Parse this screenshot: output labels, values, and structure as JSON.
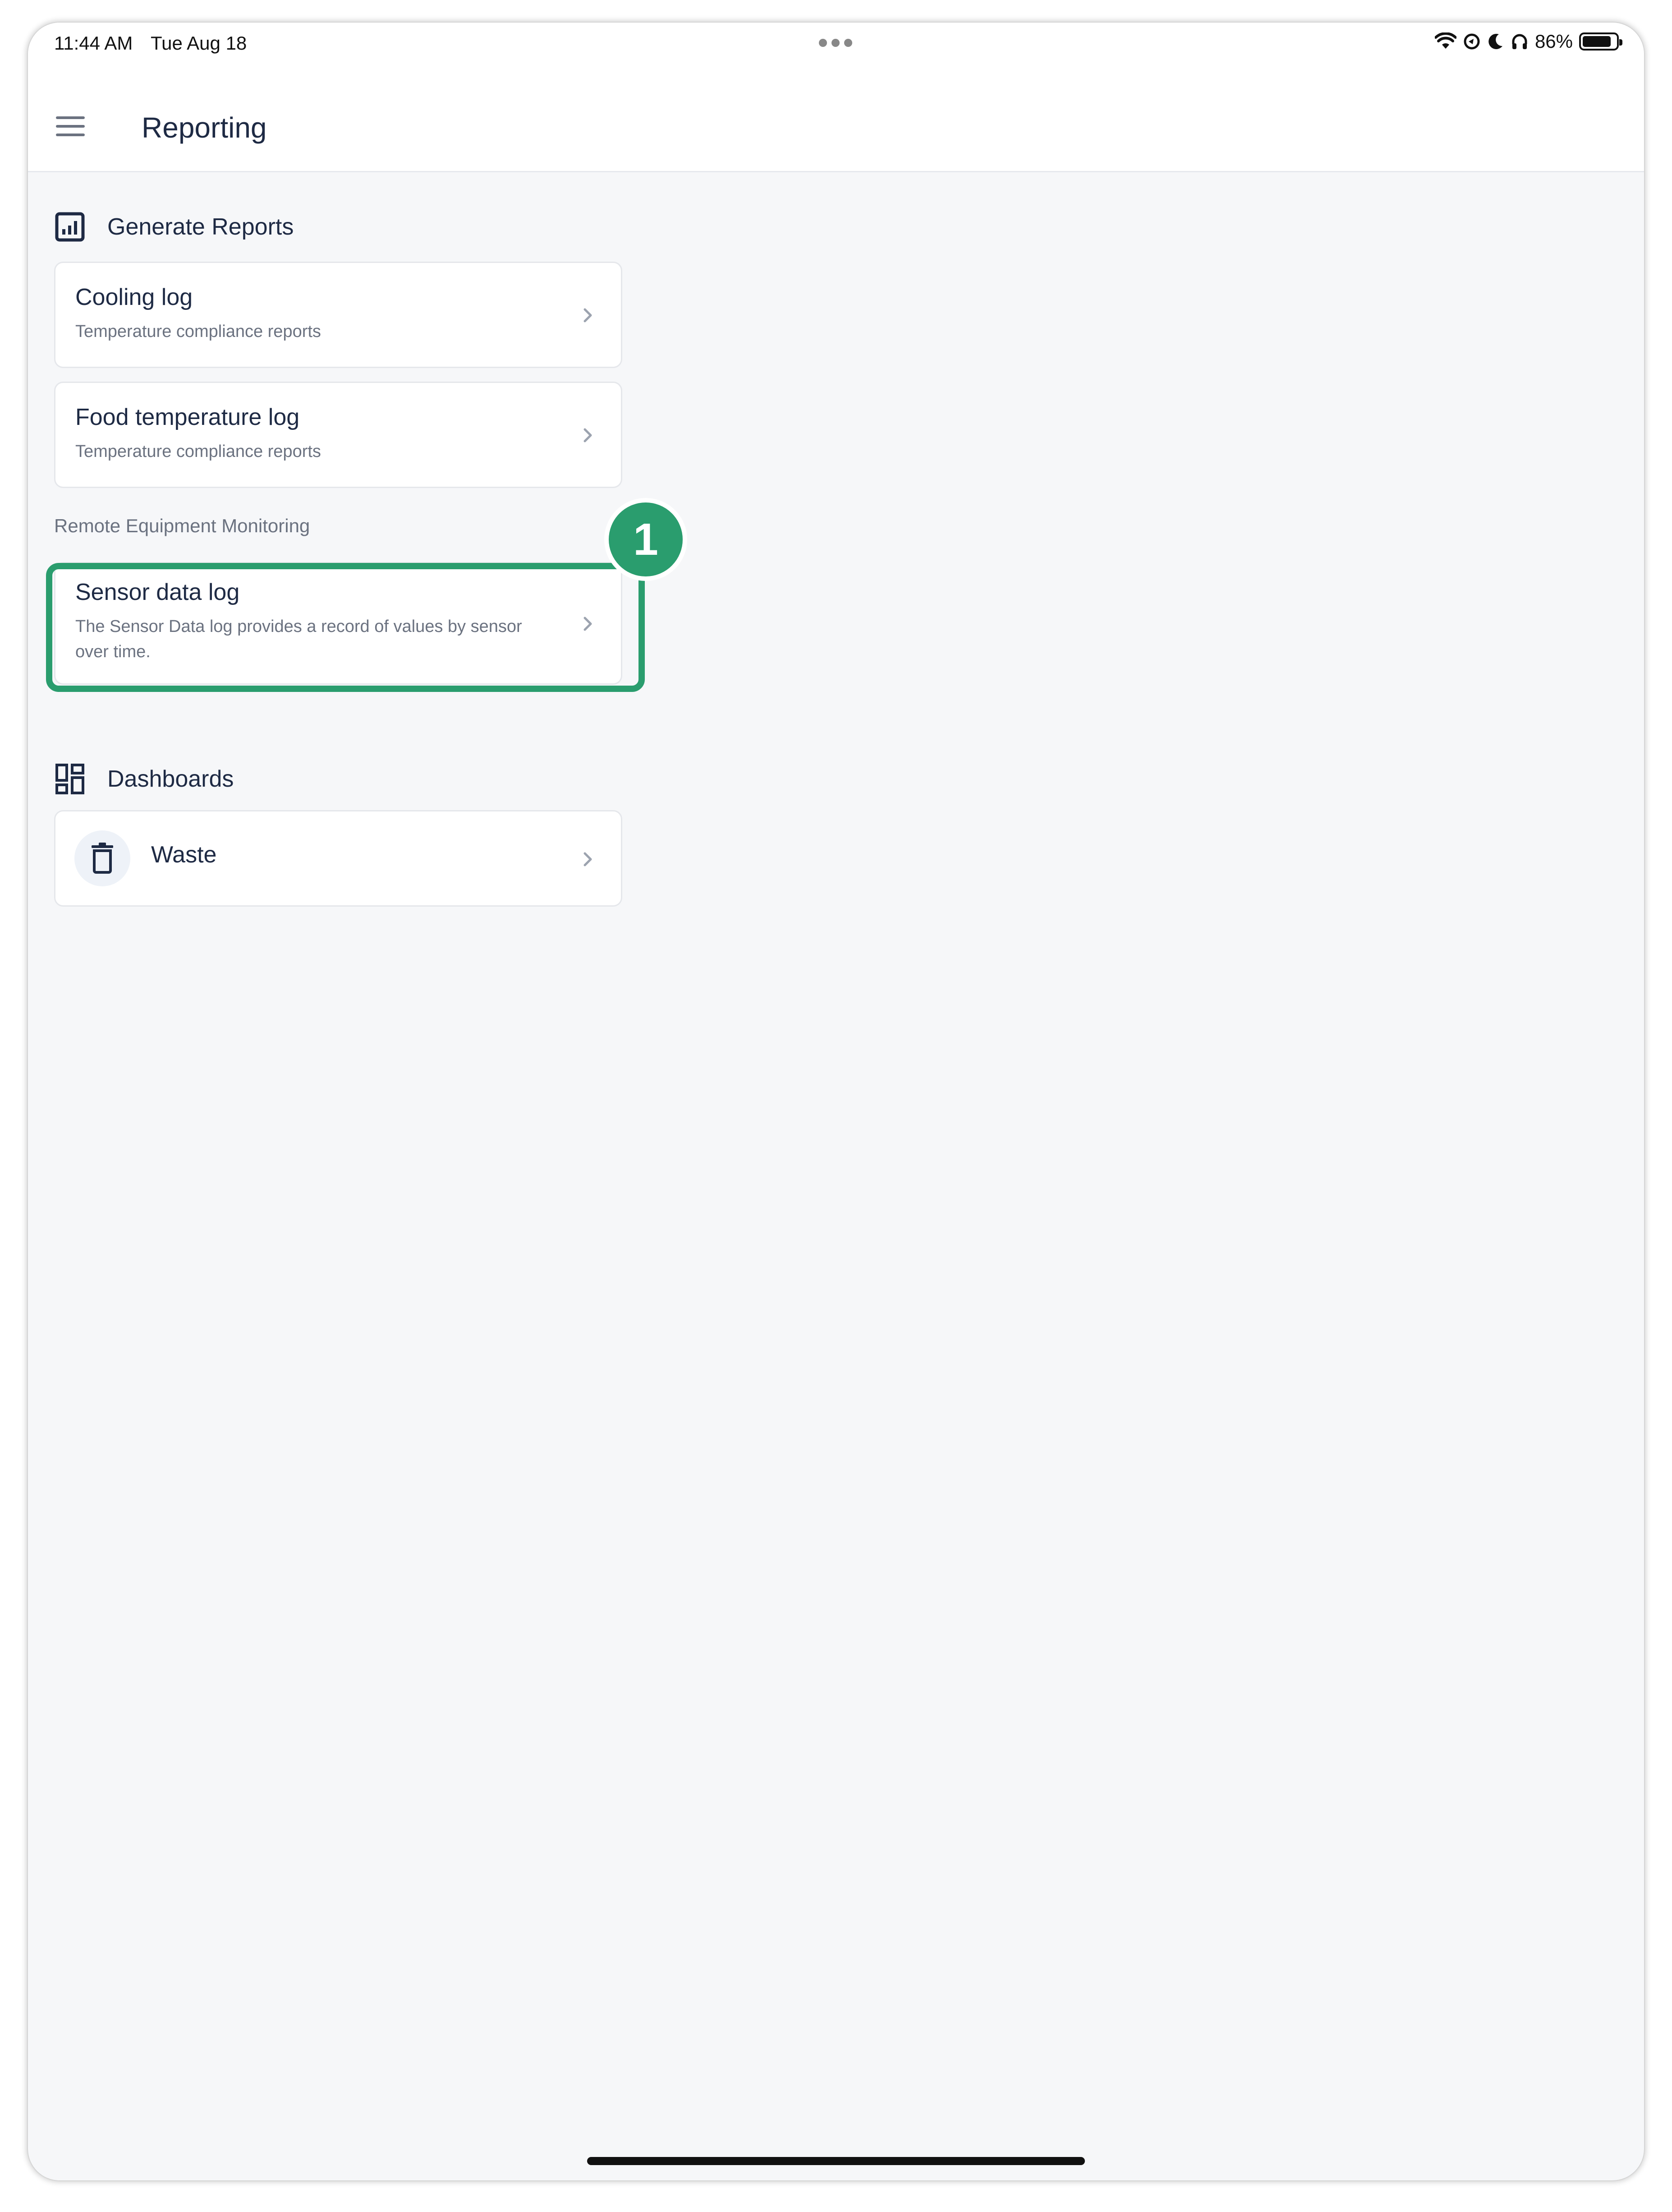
{
  "status_bar": {
    "time": "11:44 AM",
    "date": "Tue Aug 18",
    "battery_percent": "86%",
    "battery_level": 0.86,
    "icons": [
      "wifi-icon",
      "location-lock-icon",
      "moon-icon",
      "headphones-icon",
      "battery-icon"
    ]
  },
  "app_bar": {
    "title": "Reporting",
    "menu_icon": "hamburger-menu-icon"
  },
  "generate_reports": {
    "heading": "Generate Reports",
    "icon": "bar-chart-icon",
    "items": [
      {
        "title": "Cooling log",
        "subtitle": "Temperature compliance reports"
      },
      {
        "title": "Food temperature log",
        "subtitle": "Temperature compliance reports"
      }
    ]
  },
  "remote_monitoring": {
    "label": "Remote Equipment Monitoring",
    "items": [
      {
        "title": "Sensor data log",
        "subtitle": "The Sensor Data log provides a record of values by sensor over time."
      }
    ]
  },
  "callout": {
    "step": "1",
    "color": "#2a9d6e"
  },
  "dashboards": {
    "heading": "Dashboards",
    "icon": "dashboard-grid-icon",
    "items": [
      {
        "title": "Waste",
        "icon": "trash-icon"
      }
    ]
  },
  "colors": {
    "background": "#f6f7f9",
    "title_text": "#1e2a44",
    "secondary_text": "#6b7280",
    "highlight": "#2a9d6e"
  }
}
